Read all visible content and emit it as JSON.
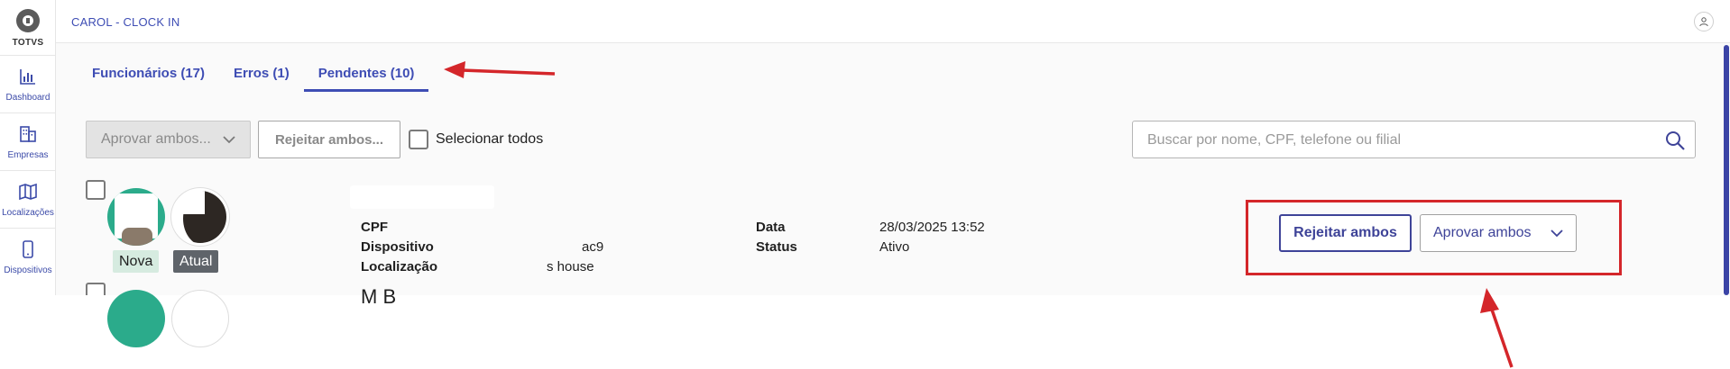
{
  "sidebar": {
    "brand": "TOTVS",
    "items": [
      {
        "label": "Dashboard",
        "icon": "bar-chart-icon"
      },
      {
        "label": "Empresas",
        "icon": "building-icon"
      },
      {
        "label": "Localizações",
        "icon": "map-icon"
      },
      {
        "label": "Dispositivos",
        "icon": "phone-icon"
      }
    ]
  },
  "header": {
    "title": "CAROL - CLOCK IN",
    "user_icon": "user-icon"
  },
  "tabs": [
    {
      "label": "Funcionários (17)"
    },
    {
      "label": "Erros (1)"
    },
    {
      "label": "Pendentes (10)",
      "active": true
    }
  ],
  "toolbar": {
    "bulk_select_label": "Aprovar ambos...",
    "bulk_reject_label": "Rejeitar ambos...",
    "select_all_label": "Selecionar todos",
    "search_placeholder": "Buscar por nome, CPF, telefone ou filial"
  },
  "record": {
    "tag_new": "Nova",
    "tag_current": "Atual",
    "fields": {
      "cpf_label": "CPF",
      "device_label": "Dispositivo",
      "device_value": "ac9",
      "location_label": "Localização",
      "location_value": "s house",
      "date_label": "Data",
      "date_value": "28/03/2025 13:52",
      "status_label": "Status",
      "status_value": "Ativo"
    },
    "reject_label": "Rejeitar ambos",
    "approve_label": "Aprovar ambos"
  },
  "next_record": {
    "name_partial": "M    B"
  },
  "colors": {
    "accent": "#3e4db4",
    "annotation_red": "#d4262a",
    "scrollbar": "#3b44a6"
  }
}
